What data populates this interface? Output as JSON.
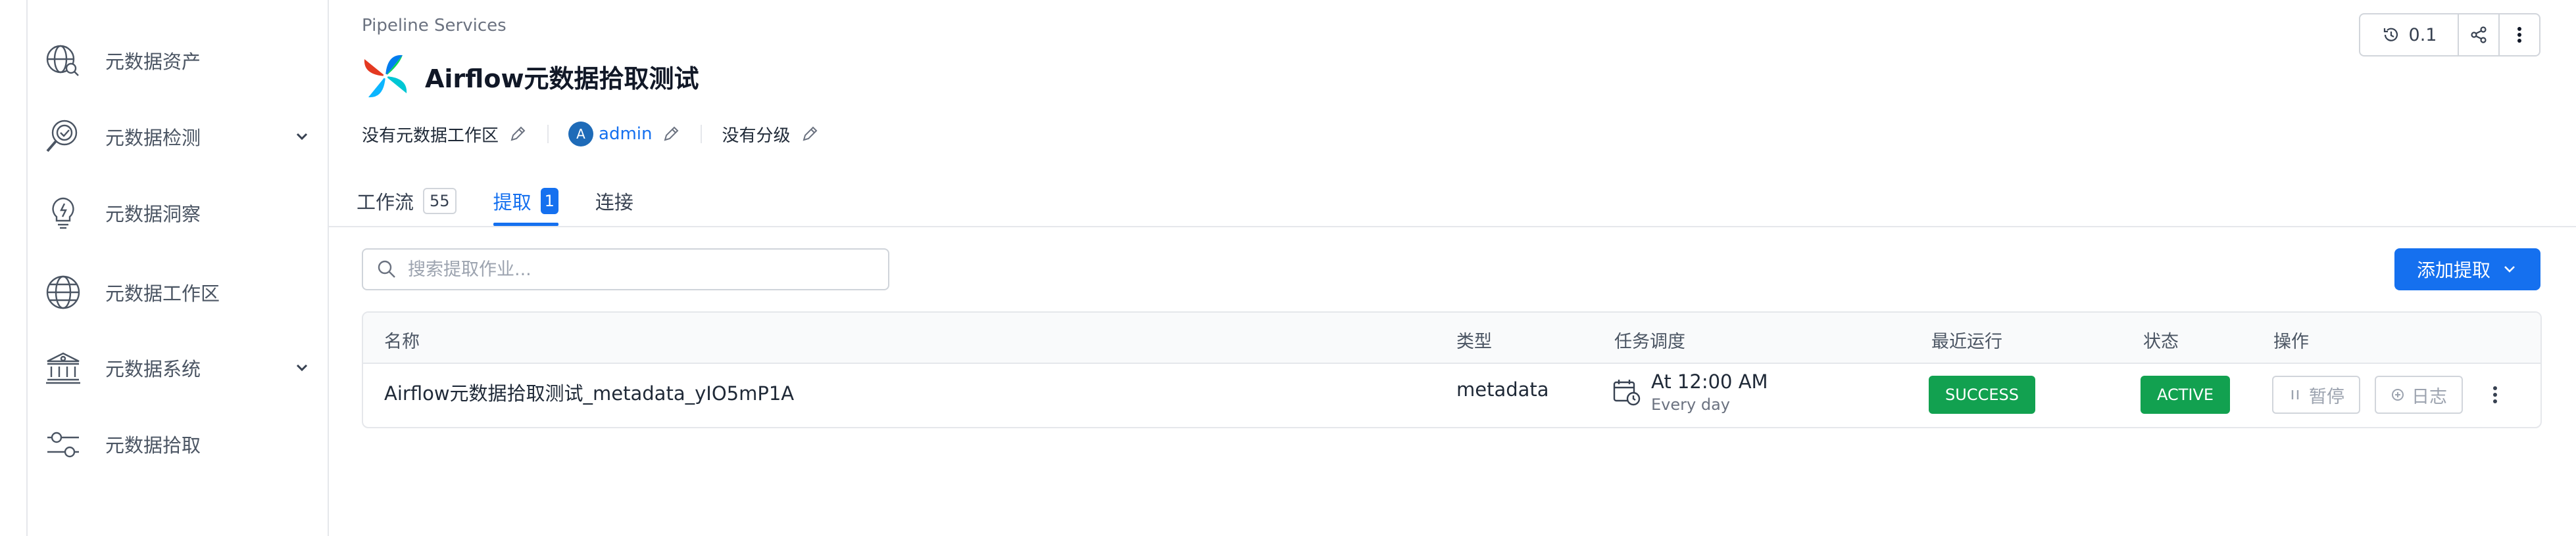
{
  "sidebar": {
    "items": [
      {
        "label": "元数据资产",
        "icon": "data-asset-icon",
        "expandable": false
      },
      {
        "label": "元数据检测",
        "icon": "data-quality-icon",
        "expandable": true
      },
      {
        "label": "元数据洞察",
        "icon": "insights-bulb-icon",
        "expandable": false
      },
      {
        "label": "元数据工作区",
        "icon": "globe-domain-icon",
        "expandable": false
      },
      {
        "label": "元数据系统",
        "icon": "governance-building-icon",
        "expandable": true
      },
      {
        "label": "元数据拾取",
        "icon": "sliders-icon",
        "expandable": false
      }
    ]
  },
  "header": {
    "breadcrumb": "Pipeline Services",
    "title": "Airflow元数据拾取测试",
    "domain": "没有元数据工作区",
    "owner_initial": "A",
    "owner": "admin",
    "tier": "没有分级",
    "version": "0.1"
  },
  "tabs": [
    {
      "label": "工作流",
      "count": "55",
      "active": false
    },
    {
      "label": "提取",
      "count": "1",
      "active": true
    },
    {
      "label": "连接",
      "count": "",
      "active": false
    }
  ],
  "search": {
    "placeholder": "搜索提取作业..."
  },
  "add_button": {
    "label": "添加提取"
  },
  "table": {
    "columns": [
      "名称",
      "类型",
      "任务调度",
      "最近运行",
      "状态",
      "操作"
    ],
    "rows": [
      {
        "name": "Airflow元数据拾取测试_metadata_yIO5mP1A",
        "type": "metadata",
        "schedule": "At 12:00 AM",
        "schedule_sub": "Every day",
        "last_run": "SUCCESS",
        "status": "ACTIVE",
        "pause_label": "暂停",
        "logs_label": "日志"
      }
    ]
  },
  "colors": {
    "accent": "#1570ef",
    "success": "#12a150",
    "avatar": "#1e6bb8"
  }
}
